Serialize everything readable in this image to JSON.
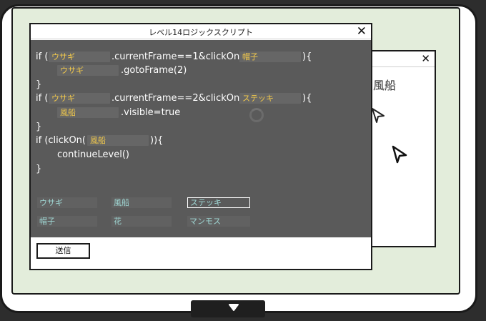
{
  "dialog": {
    "title": "レベル14ロジックスクリプト",
    "close_glyph": "✕",
    "send_label": "送信"
  },
  "background_window": {
    "close_glyph": "✕",
    "partial_text": "風船"
  },
  "code": {
    "line1": {
      "prefix": "if (",
      "slot1": "ウサギ",
      "middle": ".currentFrame==1&clickOn(",
      "slot2": "帽子",
      "suffix": "){"
    },
    "line2": {
      "slot": "ウサギ",
      "suffix": ".gotoFrame(2)"
    },
    "line3": "}",
    "line4": {
      "prefix": "if (",
      "slot1": "ウサギ",
      "middle": ".currentFrame==2&clickOn(",
      "slot2": "ステッキ",
      "suffix": "){"
    },
    "line5": {
      "slot": "風船",
      "suffix": ".visible=true"
    },
    "line6": "}",
    "line7": {
      "prefix": "if (clickOn(",
      "slot": "風船",
      "suffix": ")){"
    },
    "line8": "continueLevel()",
    "line9": "}"
  },
  "choices": [
    {
      "label": "ウサギ",
      "selected": false
    },
    {
      "label": "風船",
      "selected": false
    },
    {
      "label": "ステッキ",
      "selected": true
    },
    {
      "label": "帽子",
      "selected": false
    },
    {
      "label": "花",
      "selected": false
    },
    {
      "label": "マンモス",
      "selected": false
    }
  ],
  "colors": {
    "editor_bg": "#5a5a5a",
    "slot_text": "#f2c94c",
    "choice_text": "#9fd6d3",
    "screen_bg": "#e3eddb"
  },
  "icons": {
    "home_button": "triangle-down-icon",
    "cursor": "pointer-arrow-icon",
    "loading": "spinner-icon"
  }
}
